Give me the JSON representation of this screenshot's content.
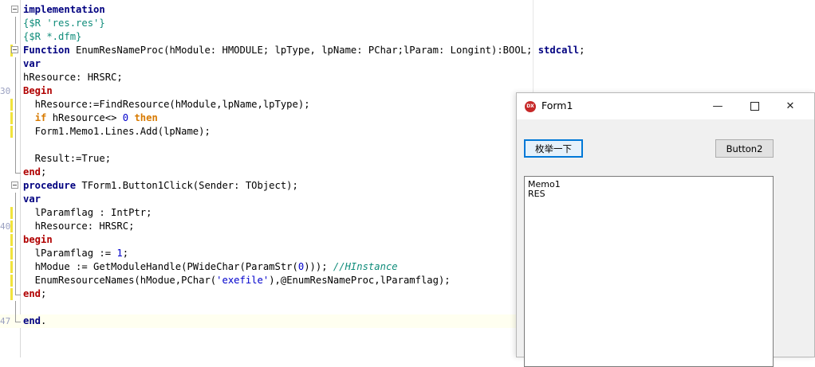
{
  "editor": {
    "lines": [
      {
        "no": "",
        "parts": [
          {
            "t": "implementation",
            "c": "kw"
          }
        ]
      },
      {
        "no": "",
        "parts": [
          {
            "t": "{$R 'res.res'}",
            "c": "dir"
          }
        ]
      },
      {
        "no": "",
        "parts": [
          {
            "t": "{$R *.dfm}",
            "c": "dir"
          }
        ]
      },
      {
        "no": "",
        "parts": [
          {
            "t": "Function ",
            "c": "kw"
          },
          {
            "t": "EnumResNameProc(hModule: HMODULE; lpType, lpName: PChar;lParam: Longint):BOOL; ",
            "c": ""
          },
          {
            "t": "stdcall",
            "c": "kw"
          },
          {
            "t": ";",
            "c": ""
          }
        ]
      },
      {
        "no": "",
        "parts": [
          {
            "t": "var",
            "c": "kw"
          }
        ]
      },
      {
        "no": "",
        "parts": [
          {
            "t": "hResource: HRSRC;",
            "c": ""
          }
        ]
      },
      {
        "no": "30",
        "parts": [
          {
            "t": "Begin",
            "c": "kwr"
          }
        ]
      },
      {
        "no": "",
        "parts": [
          {
            "t": "  hResource:=FindResource(hModule,lpName,lpType);",
            "c": ""
          }
        ]
      },
      {
        "no": "",
        "parts": [
          {
            "t": "  ",
            "c": ""
          },
          {
            "t": "if",
            "c": "kwo"
          },
          {
            "t": " hResource<> ",
            "c": ""
          },
          {
            "t": "0",
            "c": "num"
          },
          {
            "t": " ",
            "c": ""
          },
          {
            "t": "then",
            "c": "kwo"
          }
        ]
      },
      {
        "no": "",
        "parts": [
          {
            "t": "  Form1.Memo1.Lines.Add(lpName);",
            "c": ""
          }
        ]
      },
      {
        "no": "",
        "parts": []
      },
      {
        "no": "",
        "parts": [
          {
            "t": "  Result:=True;",
            "c": ""
          }
        ]
      },
      {
        "no": "",
        "parts": [
          {
            "t": "end",
            "c": "kwr"
          },
          {
            "t": ";",
            "c": ""
          }
        ]
      },
      {
        "no": "",
        "parts": [
          {
            "t": "procedure ",
            "c": "kw"
          },
          {
            "t": "TForm1.Button1Click(Sender: TObject);",
            "c": ""
          }
        ]
      },
      {
        "no": "",
        "parts": [
          {
            "t": "var",
            "c": "kw"
          }
        ]
      },
      {
        "no": "",
        "parts": [
          {
            "t": "  lParamflag : IntPtr;",
            "c": ""
          }
        ]
      },
      {
        "no": "40",
        "parts": [
          {
            "t": "  hResource: HRSRC;",
            "c": ""
          }
        ]
      },
      {
        "no": "",
        "parts": [
          {
            "t": "begin",
            "c": "kwr"
          }
        ]
      },
      {
        "no": "",
        "parts": [
          {
            "t": "  lParamflag := ",
            "c": ""
          },
          {
            "t": "1",
            "c": "num"
          },
          {
            "t": ";",
            "c": ""
          }
        ]
      },
      {
        "no": "",
        "parts": [
          {
            "t": "  hModue := GetModuleHandle(PWideChar(ParamStr(",
            "c": ""
          },
          {
            "t": "0",
            "c": "num"
          },
          {
            "t": "))); ",
            "c": ""
          },
          {
            "t": "//HInstance",
            "c": "cmt"
          }
        ]
      },
      {
        "no": "",
        "parts": [
          {
            "t": "  EnumResourceNames(hModue,PChar(",
            "c": ""
          },
          {
            "t": "'exefile'",
            "c": "str"
          },
          {
            "t": "),@EnumResNameProc,lParamflag);",
            "c": ""
          }
        ]
      },
      {
        "no": "",
        "parts": [
          {
            "t": "end",
            "c": "kwr"
          },
          {
            "t": ";",
            "c": ""
          }
        ]
      },
      {
        "no": "",
        "parts": []
      },
      {
        "no": "47",
        "parts": [
          {
            "t": "end",
            "c": "kw"
          },
          {
            "t": ".",
            "c": ""
          }
        ]
      }
    ]
  },
  "form1": {
    "title": "Form1",
    "icon_label": "DX",
    "minimize_glyph": "—",
    "close_glyph": "✕",
    "button1_label": "枚举一下",
    "button2_label": "Button2",
    "memo_lines": [
      "Memo1",
      "RES"
    ]
  },
  "colors": {
    "keyword": "#000080",
    "block_keyword": "#b00000",
    "control_keyword": "#d87a00",
    "directive": "#0f8c7a",
    "string": "#0000cc",
    "focus_border": "#0078d7"
  }
}
